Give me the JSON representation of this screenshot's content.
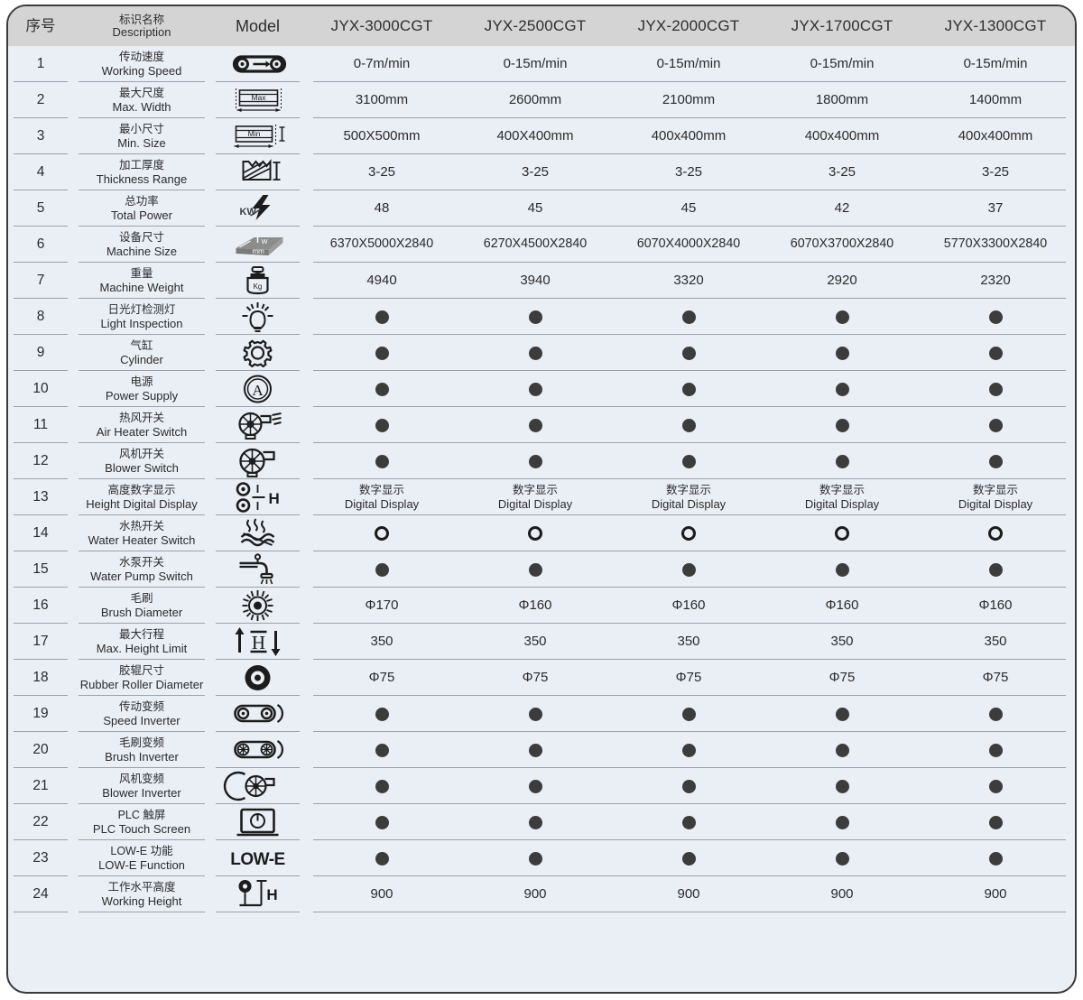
{
  "table": {
    "columns": [
      {
        "key": "seq",
        "cn": "序号",
        "en": ""
      },
      {
        "key": "desc",
        "cn": "标识名称",
        "en": "Description"
      },
      {
        "key": "model",
        "cn": "",
        "en": "Model"
      },
      {
        "key": "m3000",
        "cn": "",
        "en": "JYX-3000CGT"
      },
      {
        "key": "m2500",
        "cn": "",
        "en": "JYX-2500CGT"
      },
      {
        "key": "m2000",
        "cn": "",
        "en": "JYX-2000CGT"
      },
      {
        "key": "m1700",
        "cn": "",
        "en": "JYX-1700CGT"
      },
      {
        "key": "m1300",
        "cn": "",
        "en": "JYX-1300CGT"
      }
    ],
    "rows": [
      {
        "no": "1",
        "cn": "传动速度",
        "en": "Working Speed",
        "icon": "conveyor-arrow-icon",
        "values": [
          "0-7m/min",
          "0-15m/min",
          "0-15m/min",
          "0-15m/min",
          "0-15m/min"
        ],
        "type": "text"
      },
      {
        "no": "2",
        "cn": "最大尺度",
        "en": "Max. Width",
        "icon": "max-width-panel-icon",
        "values": [
          "3100mm",
          "2600mm",
          "2100mm",
          "1800mm",
          "1400mm"
        ],
        "type": "text"
      },
      {
        "no": "3",
        "cn": "最小尺寸",
        "en": "Min. Size",
        "icon": "min-size-panel-icon",
        "values": [
          "500X500mm",
          "400X400mm",
          "400x400mm",
          "400x400mm",
          "400x400mm"
        ],
        "type": "text"
      },
      {
        "no": "4",
        "cn": "加工厚度",
        "en": "Thickness Range",
        "icon": "thickness-range-icon",
        "values": [
          "3-25",
          "3-25",
          "3-25",
          "3-25",
          "3-25"
        ],
        "type": "text"
      },
      {
        "no": "5",
        "cn": "总功率",
        "en": "Total Power",
        "icon": "kw-bolt-icon",
        "values": [
          "48",
          "45",
          "45",
          "42",
          "37"
        ],
        "type": "text"
      },
      {
        "no": "6",
        "cn": "设备尺寸",
        "en": "Machine Size",
        "icon": "machine-size-box-icon",
        "values": [
          "6370X5000X2840",
          "6270X4500X2840",
          "6070X4000X2840",
          "6070X3700X2840",
          "5770X3300X2840"
        ],
        "type": "text-small"
      },
      {
        "no": "7",
        "cn": "重量",
        "en": "Machine Weight",
        "icon": "weight-kg-icon",
        "values": [
          "4940",
          "3940",
          "3320",
          "2920",
          "2320"
        ],
        "type": "text"
      },
      {
        "no": "8",
        "cn": "日光灯检测灯",
        "en": "Light Inspection",
        "icon": "lightbulb-icon",
        "values": [
          "filled",
          "filled",
          "filled",
          "filled",
          "filled"
        ],
        "type": "mark"
      },
      {
        "no": "9",
        "cn": "气缸",
        "en": "Cylinder",
        "icon": "gear-icon",
        "values": [
          "filled",
          "filled",
          "filled",
          "filled",
          "filled"
        ],
        "type": "mark"
      },
      {
        "no": "10",
        "cn": "电源",
        "en": "Power Supply",
        "icon": "ampere-circle-icon",
        "values": [
          "filled",
          "filled",
          "filled",
          "filled",
          "filled"
        ],
        "type": "mark"
      },
      {
        "no": "11",
        "cn": "热风开关",
        "en": "Air Heater Switch",
        "icon": "air-heater-blower-icon",
        "values": [
          "filled",
          "filled",
          "filled",
          "filled",
          "filled"
        ],
        "type": "mark"
      },
      {
        "no": "12",
        "cn": "风机开关",
        "en": "Blower Switch",
        "icon": "blower-fan-icon",
        "values": [
          "filled",
          "filled",
          "filled",
          "filled",
          "filled"
        ],
        "type": "mark"
      },
      {
        "no": "13",
        "cn": "高度数字显示",
        "en": "Height Digital Display",
        "icon": "height-digital-h-icon",
        "values": [
          "数字显示|Digital Display",
          "数字显示|Digital Display",
          "数字显示|Digital Display",
          "数字显示|Digital Display",
          "数字显示|Digital Display"
        ],
        "type": "bilingual"
      },
      {
        "no": "14",
        "cn": "水热开关",
        "en": "Water Heater Switch",
        "icon": "water-heater-icon",
        "values": [
          "hollow",
          "hollow",
          "hollow",
          "hollow",
          "hollow"
        ],
        "type": "mark"
      },
      {
        "no": "15",
        "cn": "水泵开关",
        "en": "Water Pump Switch",
        "icon": "water-tap-icon",
        "values": [
          "filled",
          "filled",
          "filled",
          "filled",
          "filled"
        ],
        "type": "mark"
      },
      {
        "no": "16",
        "cn": "毛刷",
        "en": "Brush Diameter",
        "icon": "brush-sunburst-icon",
        "values": [
          "Φ170",
          "Φ160",
          "Φ160",
          "Φ160",
          "Φ160"
        ],
        "type": "text"
      },
      {
        "no": "17",
        "cn": "最大行程",
        "en": "Max. Height Limit",
        "icon": "height-limit-arrows-icon",
        "values": [
          "350",
          "350",
          "350",
          "350",
          "350"
        ],
        "type": "text"
      },
      {
        "no": "18",
        "cn": "胶辊尺寸",
        "en": "Rubber Roller Diameter",
        "icon": "rubber-roller-icon",
        "values": [
          "Φ75",
          "Φ75",
          "Φ75",
          "Φ75",
          "Φ75"
        ],
        "type": "text"
      },
      {
        "no": "19",
        "cn": "传动变频",
        "en": "Speed Inverter",
        "icon": "speed-inverter-belt-icon",
        "values": [
          "filled",
          "filled",
          "filled",
          "filled",
          "filled"
        ],
        "type": "mark"
      },
      {
        "no": "20",
        "cn": "毛刷变频",
        "en": "Brush Inverter",
        "icon": "brush-inverter-belt-icon",
        "values": [
          "filled",
          "filled",
          "filled",
          "filled",
          "filled"
        ],
        "type": "mark"
      },
      {
        "no": "21",
        "cn": "风机变频",
        "en": "Blower Inverter",
        "icon": "blower-inverter-icon",
        "values": [
          "filled",
          "filled",
          "filled",
          "filled",
          "filled"
        ],
        "type": "mark"
      },
      {
        "no": "22",
        "cn": "PLC 触屏",
        "en": "PLC Touch Screen",
        "icon": "plc-touch-screen-icon",
        "values": [
          "filled",
          "filled",
          "filled",
          "filled",
          "filled"
        ],
        "type": "mark"
      },
      {
        "no": "23",
        "cn": "LOW-E 功能",
        "en": "LOW-E Function",
        "icon": "low-e-text-icon",
        "values": [
          "filled",
          "filled",
          "filled",
          "filled",
          "filled"
        ],
        "type": "mark"
      },
      {
        "no": "24",
        "cn": "工作水平高度",
        "en": "Working Height",
        "icon": "working-height-h-icon",
        "values": [
          "900",
          "900",
          "900",
          "900",
          "900"
        ],
        "type": "text"
      }
    ]
  },
  "colors": {
    "header_band": "#d4d4d4",
    "body_background": "#eaeef5",
    "frame_border": "#3a3a3a",
    "separator": "#9aa2ae",
    "text": "#2b2b2b",
    "mark_filled": "#3c3c3c",
    "mark_hollow_stroke": "#1c1c1c"
  }
}
